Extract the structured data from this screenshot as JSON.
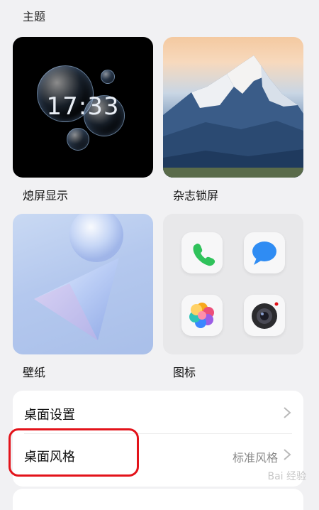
{
  "section": {
    "title": "主题"
  },
  "tiles": {
    "aod": {
      "label": "熄屏显示",
      "time": "17:33"
    },
    "magazine": {
      "label": "杂志锁屏"
    },
    "wallpaper": {
      "label": "壁纸"
    },
    "icons": {
      "label": "图标",
      "apps": [
        "phone-icon",
        "messages-icon",
        "gallery-icon",
        "camera-icon"
      ]
    }
  },
  "settings": {
    "desktop_settings": {
      "label": "桌面设置"
    },
    "desktop_style": {
      "label": "桌面风格",
      "value": "标准风格"
    }
  },
  "colors": {
    "highlight": "#e3131a",
    "phone_green": "#2fc25b",
    "messages_blue": "#2f8cf3"
  },
  "watermark": "Bai 经验"
}
